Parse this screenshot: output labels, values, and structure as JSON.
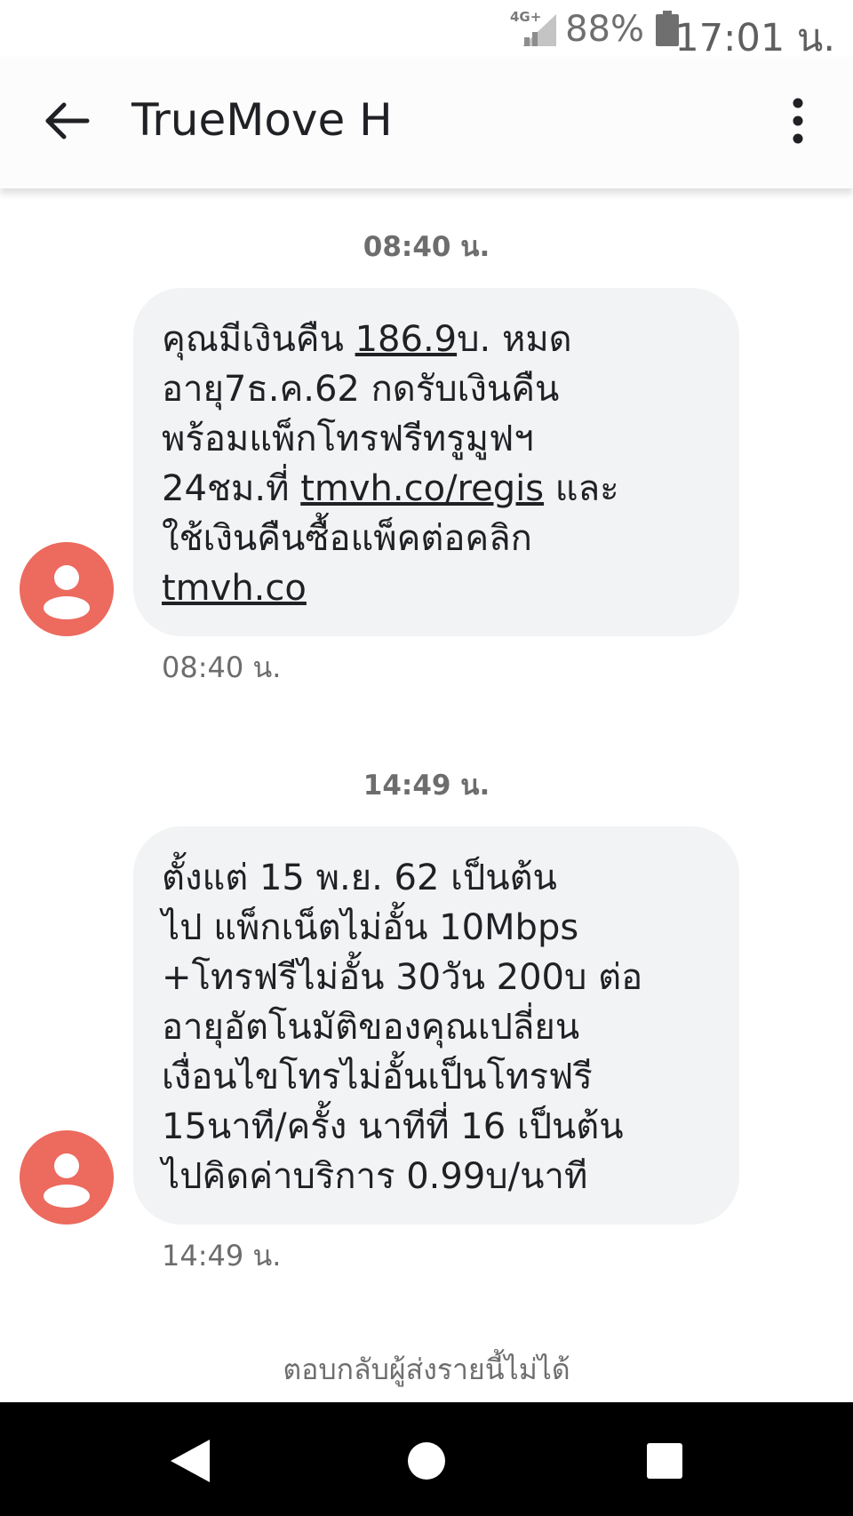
{
  "status_bar": {
    "network_type": "4G+",
    "battery_percent": "88%",
    "time": "17:01 น.",
    "icons": [
      "signal-icon",
      "battery-icon"
    ]
  },
  "app_bar": {
    "title": "TrueMove H",
    "icons": [
      "back-arrow-icon",
      "more-vert-icon"
    ]
  },
  "messages": [
    {
      "day_stamp": "08:40 น.",
      "time": "08:40 น.",
      "lines": [
        [
          "คุณมีเงินคืน ",
          "186.9",
          "บ. หมด"
        ],
        [
          "อายุ7ธ.ค.62 กดรับเงินคืน"
        ],
        [
          "พร้อมแพ็กโทรฟรีทรูมูฟฯ"
        ],
        [
          "24ชม.ที่ ",
          "tmvh.co/regis",
          " และ"
        ],
        [
          "ใช้เงินคืนซื้อแพ็คต่อคลิก"
        ],
        [
          "tmvh.co"
        ]
      ]
    },
    {
      "day_stamp": "14:49 น.",
      "time": "14:49 น.",
      "lines": [
        "ตั้งแต่ 15 พ.ย. 62 เป็นต้น",
        "ไป แพ็กเน็ตไม่อั้น 10Mbps",
        "+โทรฟรีไม่อั้น 30วัน 200บ ต่อ",
        "อายุอัตโนมัติของคุณเปลี่ยน",
        "เงื่อนไขโทรไม่อั้นเป็นโทรฟรี",
        "15นาที/ครั้ง นาทีที่ 16 เป็นต้น",
        "ไปคิดค่าบริการ 0.99บ/นาที"
      ]
    }
  ],
  "footer_notice": "ตอบกลับผู้ส่งรายนี้ไม่ได้",
  "nav_bar": {
    "icons": [
      "nav-back-icon",
      "nav-home-icon",
      "nav-recents-icon"
    ]
  },
  "colors": {
    "avatar": "#ec6a5e",
    "bubble": "#f1f3f4",
    "nav_bar": "#000000"
  }
}
